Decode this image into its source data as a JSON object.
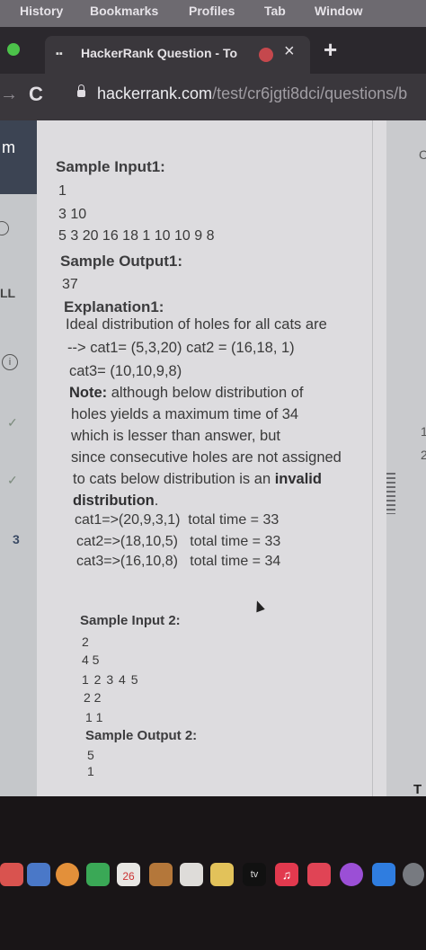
{
  "menubar": {
    "items": [
      "History",
      "Bookmarks",
      "Profiles",
      "Tab",
      "Window"
    ]
  },
  "tab": {
    "title": "HackerRank Question - To",
    "close": "×"
  },
  "new_tab": "+",
  "address": {
    "host": "hackerrank.com",
    "path": "/test/cr6jgti8dci/questions/b"
  },
  "sidebar": {
    "logo": "m",
    "labels": [
      "LL",
      "3"
    ],
    "icons": [
      "info-icon",
      "check-icon",
      "check-icon"
    ]
  },
  "right_gutter_letter": "T",
  "content": {
    "sample_input1_heading": "Sample Input1:",
    "sample_input1_lines": [
      "1",
      "3 10",
      "5 3 20 16 18 1 10 10 9 8"
    ],
    "sample_output1_heading": "Sample Output1:",
    "sample_output1_value": "37",
    "explanation_heading": "Explanation1:",
    "explanation_lines": [
      "Ideal distribution of holes for all cats are",
      "--> cat1= (5,3,20)   cat2 = (16,18, 1)",
      "cat3= (10,10,9,8)"
    ],
    "note_label": "Note:",
    "note_text_1": " although below distribution of",
    "note_lines": [
      "holes yields a maximum time of 34",
      "which is lesser than answer, but",
      "since consecutive holes are not assigned"
    ],
    "note_line_6_pre": "to cats below distribution is an ",
    "note_invalid": "invalid",
    "note_distribution": "distribution",
    "note_period": ".",
    "cat_lines": [
      "cat1=>(20,9,3,1)  total time = 33",
      "cat2=>(18,10,5)   total time = 33",
      "cat3=>(16,10,8)   total time = 34"
    ],
    "sample_input2_heading": "Sample Input 2:",
    "sample_input2_lines": [
      "2",
      "4 5",
      "1 2 3 4 5",
      "2 2",
      "1 1"
    ],
    "sample_output2_heading": "Sample Output 2:",
    "sample_output2_lines": [
      "5",
      "1"
    ]
  },
  "dock": {
    "calendar_day": "26",
    "tv_label": "tv"
  },
  "colors": {
    "sidebar_logo_bg": "#3c4453",
    "content_bg": "#dddcdf",
    "tab_media_dot": "#c5484d"
  }
}
